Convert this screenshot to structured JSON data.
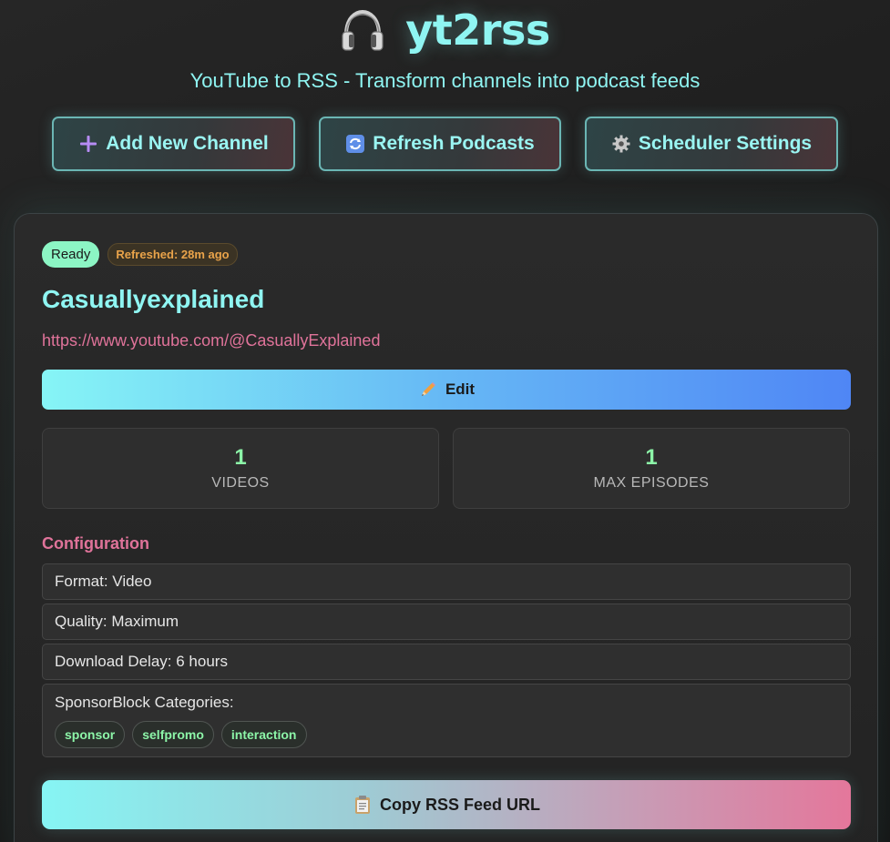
{
  "header": {
    "title": "yt2rss",
    "subtitle": "YouTube to RSS - Transform channels into podcast feeds",
    "logo_icon": "headphones-icon"
  },
  "actions": {
    "add_channel": "Add New Channel",
    "refresh": "Refresh Podcasts",
    "scheduler": "Scheduler Settings"
  },
  "channel": {
    "status": "Ready",
    "refreshed": "Refreshed: 28m ago",
    "name": "Casuallyexplained",
    "url": "https://www.youtube.com/@CasuallyExplained",
    "edit_label": "Edit",
    "stats": {
      "videos_value": "1",
      "videos_label": "VIDEOS",
      "max_episodes_value": "1",
      "max_episodes_label": "MAX EPISODES"
    },
    "config": {
      "title": "Configuration",
      "format": "Format: Video",
      "quality": "Quality: Maximum",
      "download_delay": "Download Delay: 6 hours",
      "sponsorblock_label": "SponsorBlock Categories:",
      "sponsorblock_tags": [
        "sponsor",
        "selfpromo",
        "interaction"
      ]
    },
    "copy_label": "Copy RSS Feed URL"
  },
  "colors": {
    "accent": "#8ff5f2",
    "pink": "#e0739a",
    "green": "#8cf5a8",
    "background": "#1e1e1e"
  }
}
